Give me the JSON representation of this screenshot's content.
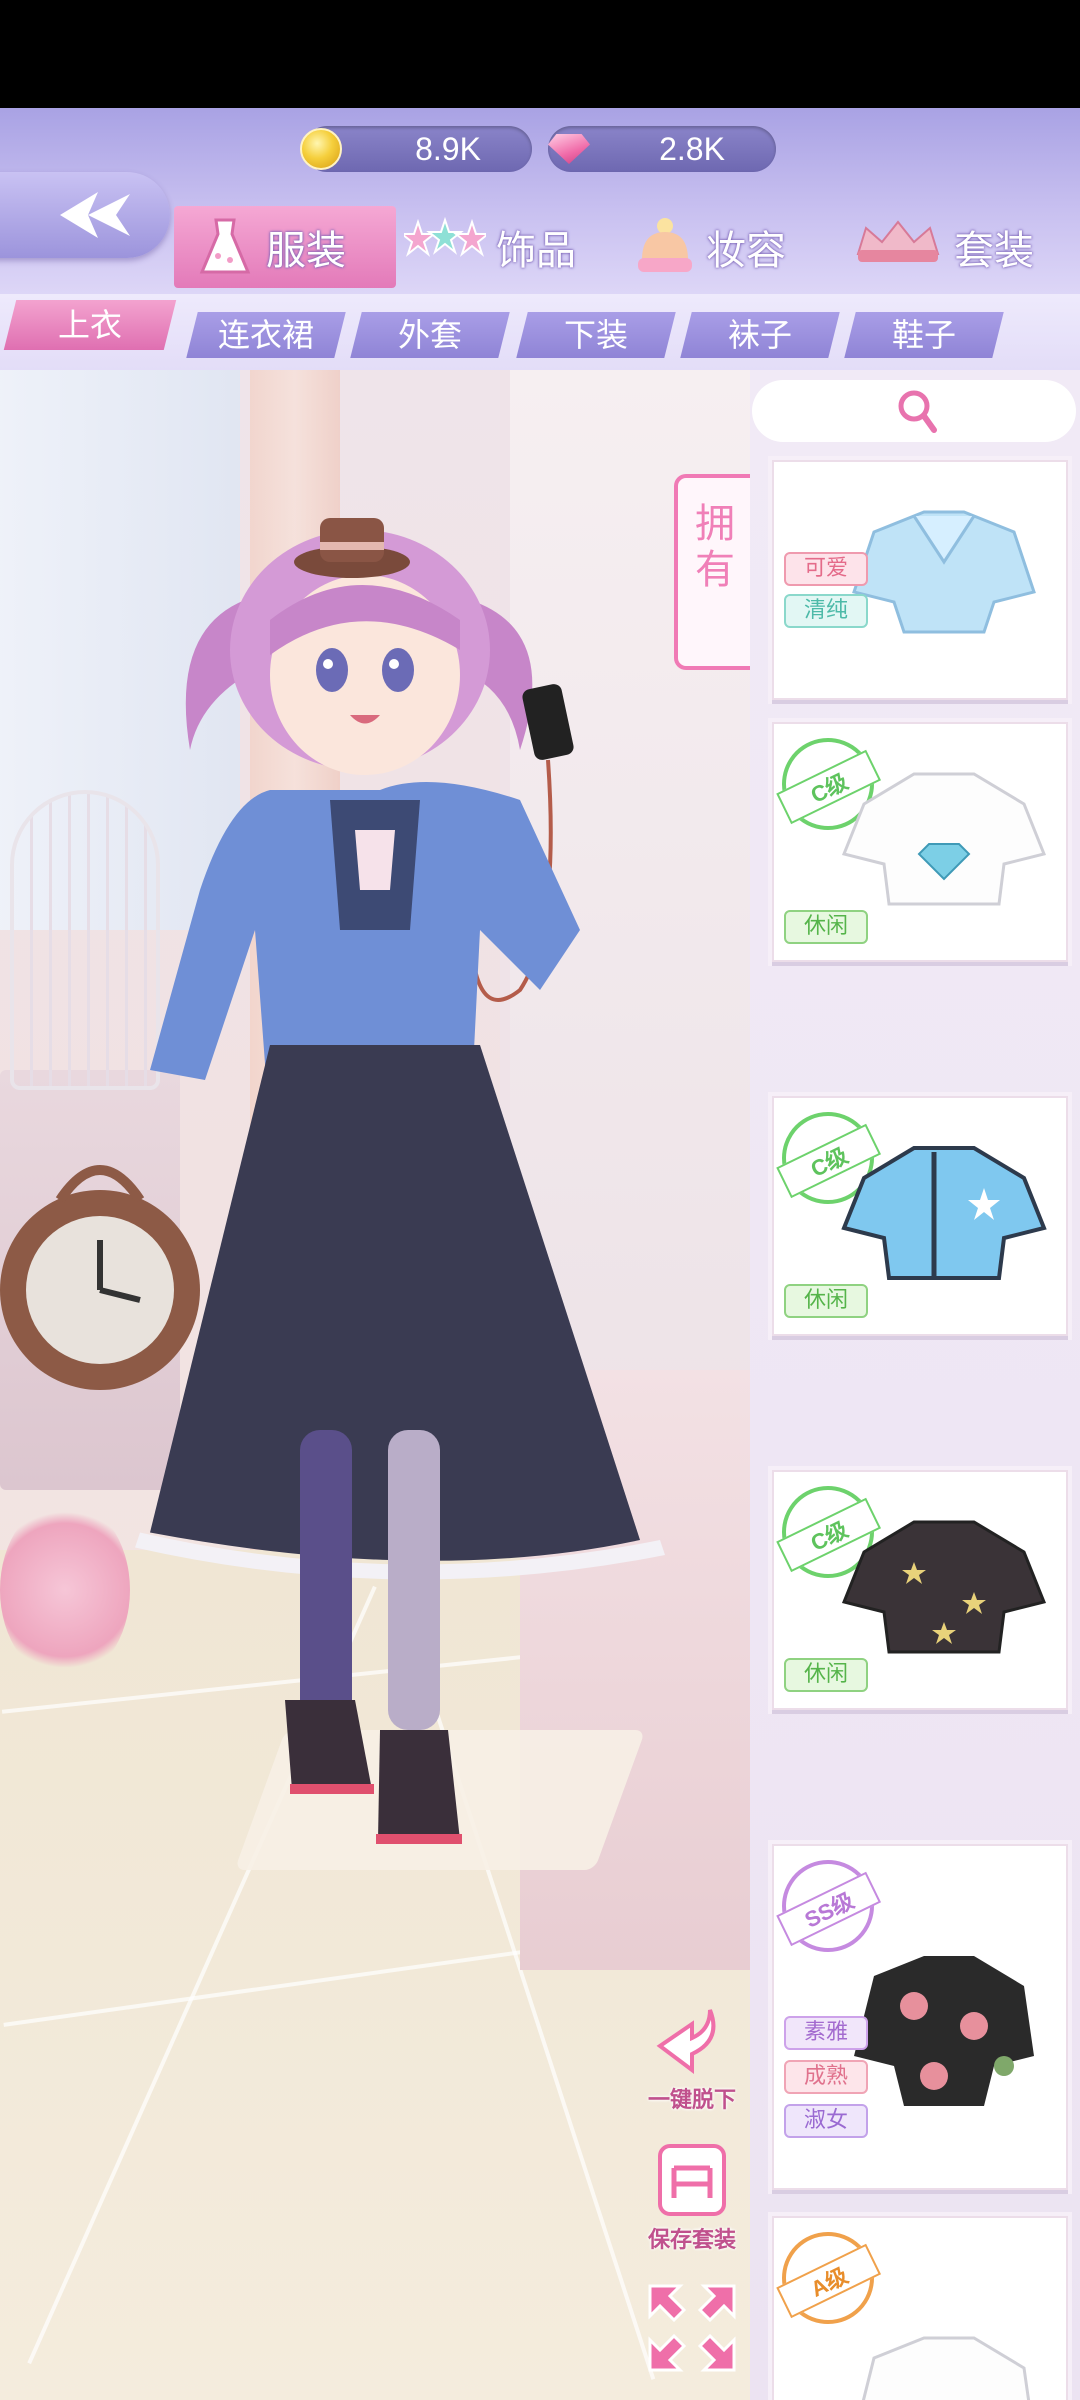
{
  "currency": {
    "gold": "8.9K",
    "diamond": "2.8K"
  },
  "nav": {
    "back_icon": "back-arrow-icon"
  },
  "categories": [
    {
      "label": "服装",
      "icon": "dress-icon",
      "active": true
    },
    {
      "label": "饰品",
      "icon": "stars-icon",
      "active": false
    },
    {
      "label": "妆容",
      "icon": "beanie-icon",
      "active": false
    },
    {
      "label": "套装",
      "icon": "crown-icon",
      "active": false
    }
  ],
  "subtabs": [
    {
      "label": "上衣",
      "active": true
    },
    {
      "label": "连衣裙",
      "active": false
    },
    {
      "label": "外套",
      "active": false
    },
    {
      "label": "下装",
      "active": false
    },
    {
      "label": "袜子",
      "active": false
    },
    {
      "label": "鞋子",
      "active": false
    }
  ],
  "side": {
    "owned_label": "拥有",
    "undress_label": "一键脱下",
    "save_label": "保存套装",
    "fullscreen_icon": "expand-icon"
  },
  "items": [
    {
      "grade": "",
      "garment": "light-blue-sailor-crop-top",
      "color": "#bfe3f7",
      "tags": [
        "可爱",
        "清纯"
      ]
    },
    {
      "grade": "C级",
      "garment": "white-diamond-tee",
      "color": "#ffffff",
      "tags": [
        "休闲"
      ]
    },
    {
      "grade": "C级",
      "garment": "blue-star-tee",
      "color": "#7fc8ef",
      "tags": [
        "休闲"
      ]
    },
    {
      "grade": "C级",
      "garment": "black-star-tee",
      "color": "#3a3337",
      "tags": [
        "休闲"
      ]
    },
    {
      "grade": "SS级",
      "garment": "black-rose-top",
      "color": "#2a2a2a",
      "tags": [
        "素雅",
        "成熟",
        "淑女"
      ]
    },
    {
      "grade": "A级",
      "garment": "white-blouse",
      "color": "#ffffff",
      "tags": []
    }
  ]
}
